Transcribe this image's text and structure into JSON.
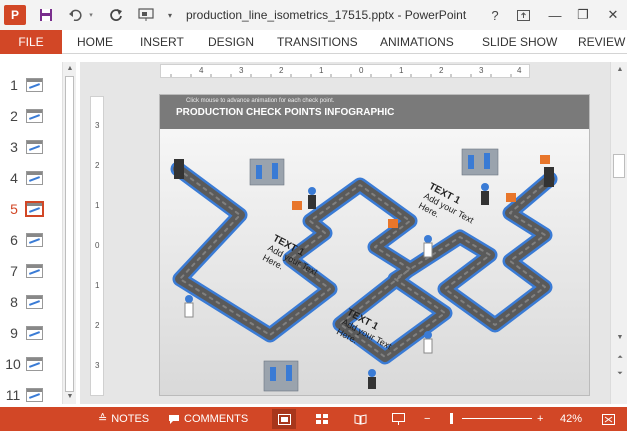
{
  "title_bar": {
    "app_icon": "P",
    "document_title": "production_line_isometrics_17515.pptx - PowerPoint",
    "icons": [
      "save-icon",
      "undo-icon",
      "redo-icon",
      "present-from-start-icon",
      "customize-qat-icon"
    ],
    "window_buttons": [
      "help-icon",
      "ribbon-display-icon",
      "minimize-icon",
      "restore-icon",
      "close-icon"
    ],
    "help_label": "?",
    "minimize_label": "—",
    "restore_label": "❐",
    "close_label": "✕"
  },
  "ribbon": {
    "file_tab": "FILE",
    "tabs": [
      "HOME",
      "INSERT",
      "DESIGN",
      "TRANSITIONS",
      "ANIMATIONS",
      "SLIDE SHOW",
      "REVIEW"
    ]
  },
  "thumbnails": {
    "numbers": [
      "1",
      "2",
      "3",
      "4",
      "5",
      "6",
      "7",
      "8",
      "9",
      "10",
      "11"
    ],
    "active_index": 4
  },
  "ruler": {
    "horizontal": [
      "4",
      "3",
      "2",
      "1",
      "0",
      "1",
      "2",
      "3",
      "4"
    ],
    "vertical": [
      "3",
      "2",
      "1",
      "0",
      "1",
      "2",
      "3"
    ]
  },
  "slide": {
    "hint": "Click mouse to advance animation for each check point.",
    "title": "PRODUCTION CHECK POINTS INFOGRAPHIC",
    "callouts": [
      {
        "title": "TEXT 1",
        "body": "Add your Text Here."
      },
      {
        "title": "TEXT 1",
        "body": "Add your Text Here."
      },
      {
        "title": "TEXT 1",
        "body": "Add your Text Here."
      }
    ]
  },
  "status_bar": {
    "notes_label": "NOTES",
    "comments_label": "COMMENTS",
    "zoom_level": "42%",
    "zoom_minus": "−",
    "zoom_plus": "+"
  },
  "colors": {
    "accent": "#d24726",
    "belt": "#5a5a5a",
    "frame": "#3a7bd5"
  }
}
